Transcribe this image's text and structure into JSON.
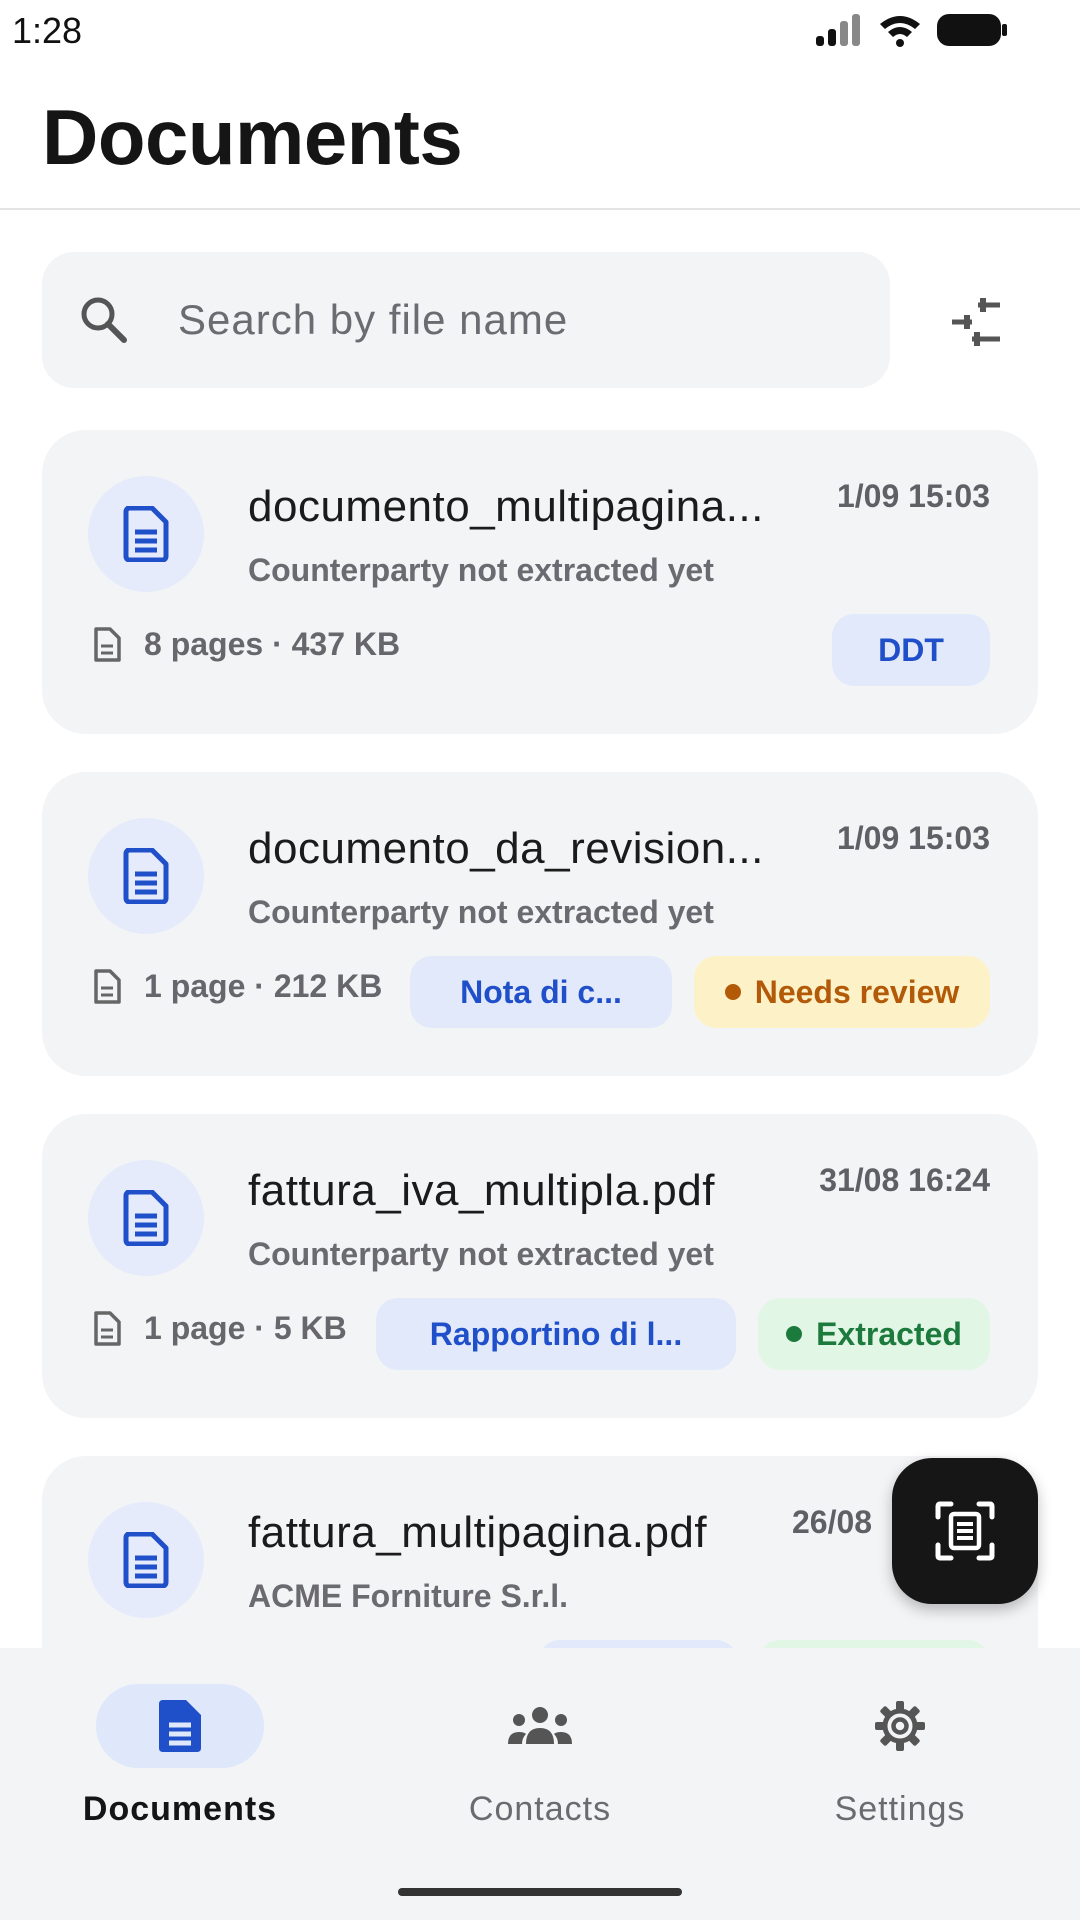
{
  "status_bar": {
    "time": "1:28"
  },
  "header": {
    "title": "Documents"
  },
  "search": {
    "placeholder": "Search by file name",
    "value": ""
  },
  "documents": [
    {
      "name": "documento_multipagina...",
      "date": "1/09 15:03",
      "counterparty": "Counterparty not extracted yet",
      "meta": "8 pages · 437 KB",
      "type_label": "DDT",
      "status_label": ""
    },
    {
      "name": "documento_da_revision...",
      "date": "1/09 15:03",
      "counterparty": "Counterparty not extracted yet",
      "meta": "1 page · 212 KB",
      "type_label": "Nota di c...",
      "status_label": "Needs review"
    },
    {
      "name": "fattura_iva_multipla.pdf",
      "date": "31/08 16:24",
      "counterparty": "Counterparty not extracted yet",
      "meta": "1 page · 5 KB",
      "type_label": "Rapportino di l...",
      "status_label": "Extracted"
    },
    {
      "name": "fattura_multipagina.pdf",
      "date": "26/08",
      "counterparty": "ACME Forniture S.r.l.",
      "meta": "",
      "type_label": "",
      "status_label": ""
    }
  ],
  "bottom_nav": {
    "items": [
      {
        "label": "Documents",
        "icon": "document-icon",
        "active": true
      },
      {
        "label": "Contacts",
        "icon": "people-icon",
        "active": false
      },
      {
        "label": "Settings",
        "icon": "gear-icon",
        "active": false
      }
    ]
  },
  "colors": {
    "accent": "#1f4fc9",
    "card_bg": "#f3f4f6",
    "review": "#b35a09",
    "extracted": "#1d7a3d"
  }
}
